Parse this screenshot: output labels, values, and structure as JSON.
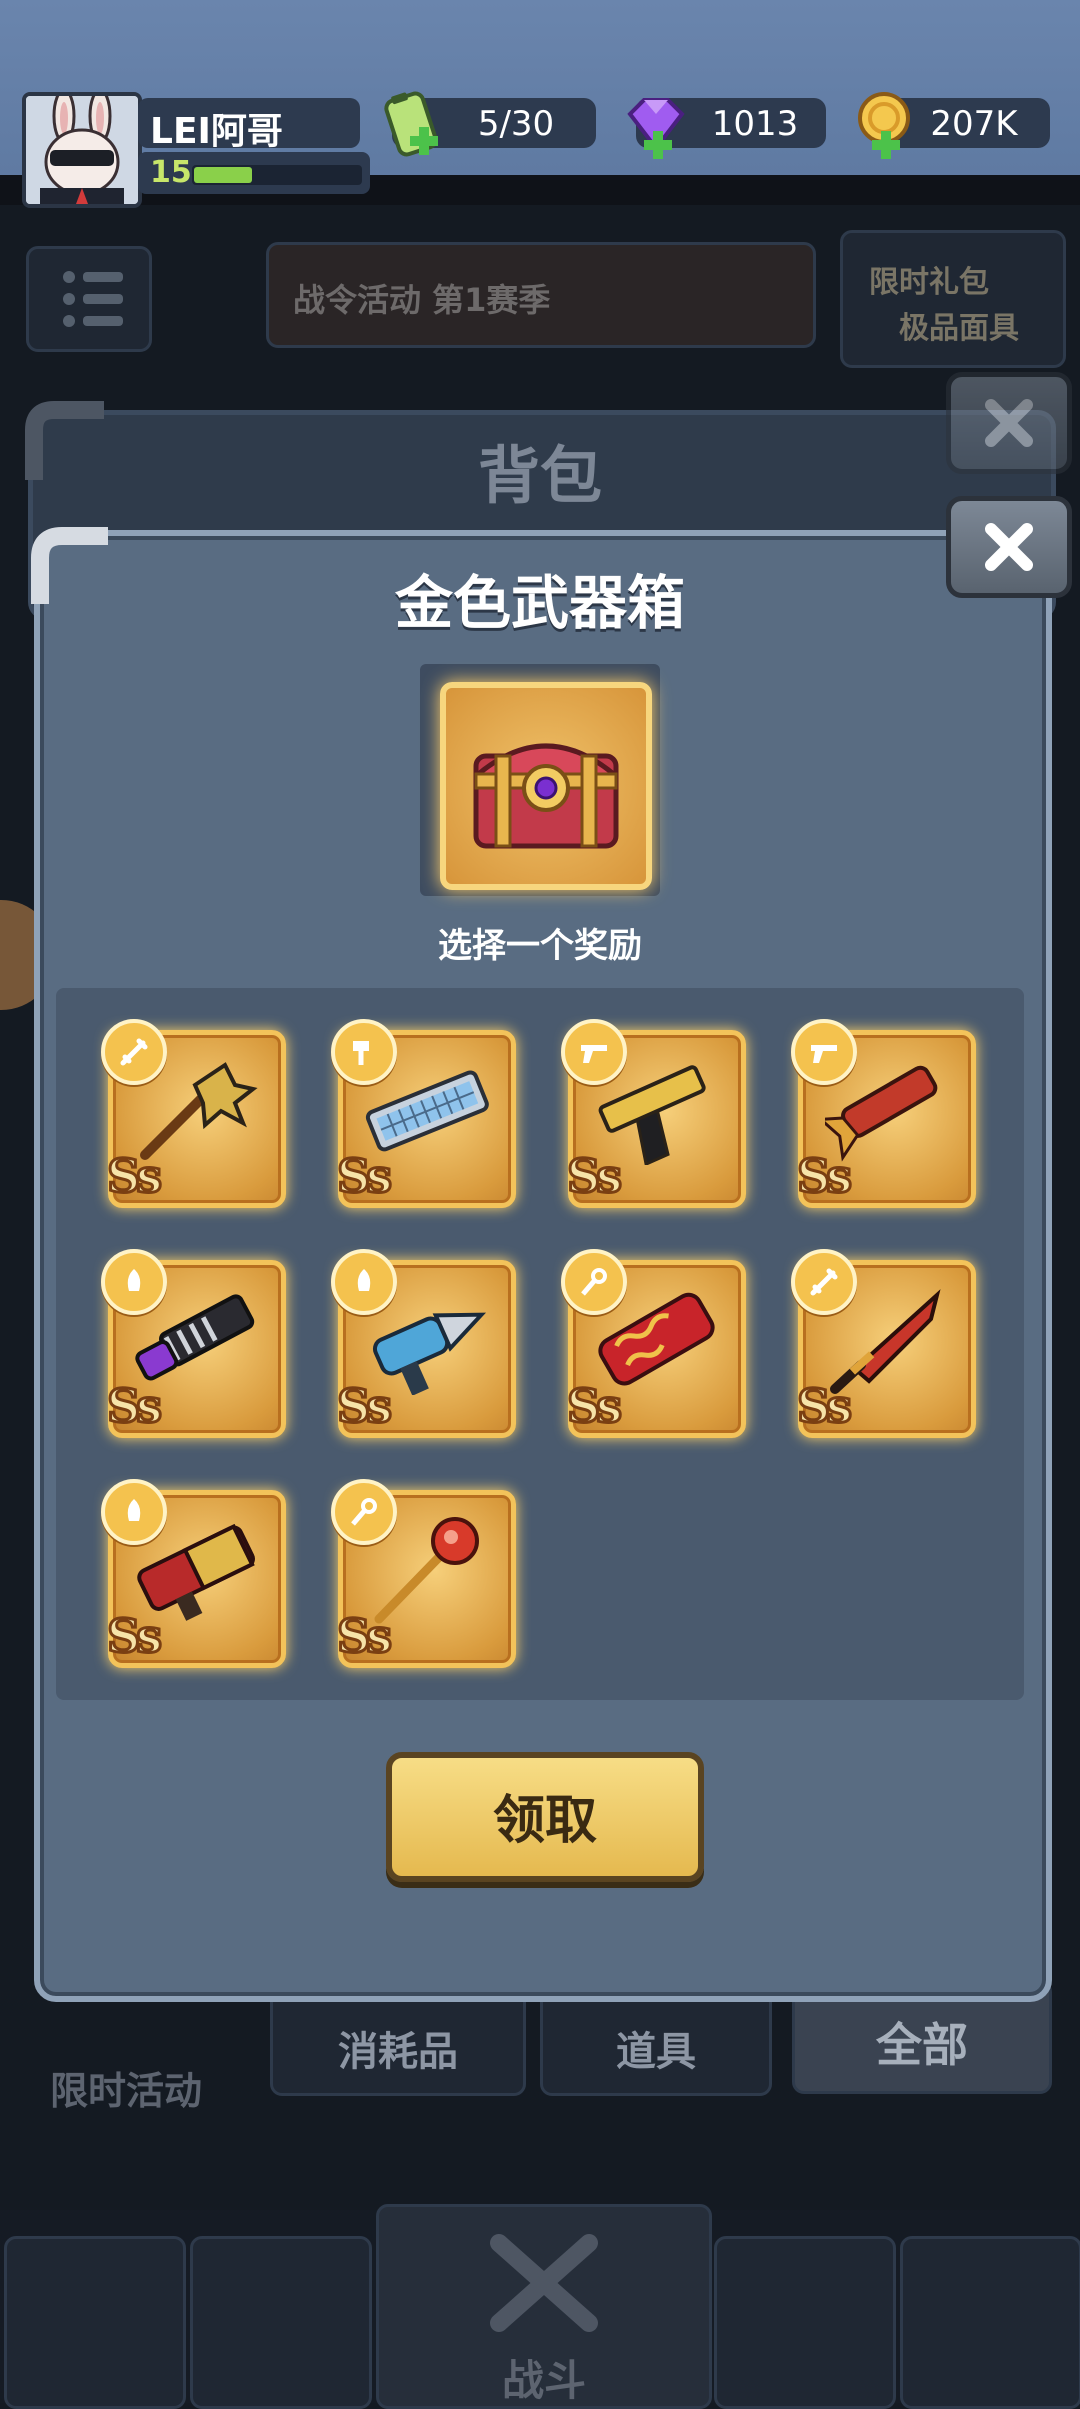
{
  "player": {
    "name": "LEI阿哥",
    "level": "15",
    "xp_fraction": 0.35
  },
  "resources": {
    "energy": "5/30",
    "gems": "1013",
    "gold": "207K"
  },
  "background": {
    "event_banner": "战令活动 第1赛季",
    "promo_banner_line1": "限时礼包",
    "promo_banner_line2": "极品面具",
    "bag_title": "背包",
    "tabs": [
      "消耗品",
      "道具",
      "全部"
    ],
    "side_label": "限时活动",
    "battle_label": "战斗"
  },
  "modal": {
    "title": "金色武器箱",
    "subtitle": "选择一个奖励",
    "claim_label": "领取",
    "rewards": [
      {
        "rank": "Ss",
        "badge": "sword-icon",
        "weapon": "dragon-claw-mace"
      },
      {
        "rank": "Ss",
        "badge": "hammer-icon",
        "weapon": "keyboard-weapon"
      },
      {
        "rank": "Ss",
        "badge": "pistol-icon",
        "weapon": "golden-desert-pistol"
      },
      {
        "rank": "Ss",
        "badge": "pistol-icon",
        "weapon": "dragon-cannon"
      },
      {
        "rank": "Ss",
        "badge": "rocket-icon",
        "weapon": "purple-gatling"
      },
      {
        "rank": "Ss",
        "badge": "rocket-icon",
        "weapon": "drill-blaster"
      },
      {
        "rank": "Ss",
        "badge": "staff-icon",
        "weapon": "firecracker-launcher"
      },
      {
        "rank": "Ss",
        "badge": "sword-icon",
        "weapon": "crimson-blade"
      },
      {
        "rank": "Ss",
        "badge": "rocket-icon",
        "weapon": "red-rocket-launcher"
      },
      {
        "rank": "Ss",
        "badge": "staff-icon",
        "weapon": "ruby-staff"
      }
    ]
  },
  "colors": {
    "accent_gold": "#f3c35a",
    "panel": "#596c82",
    "xp_green": "#8ad04a",
    "gem_purple": "#a05cf0"
  }
}
